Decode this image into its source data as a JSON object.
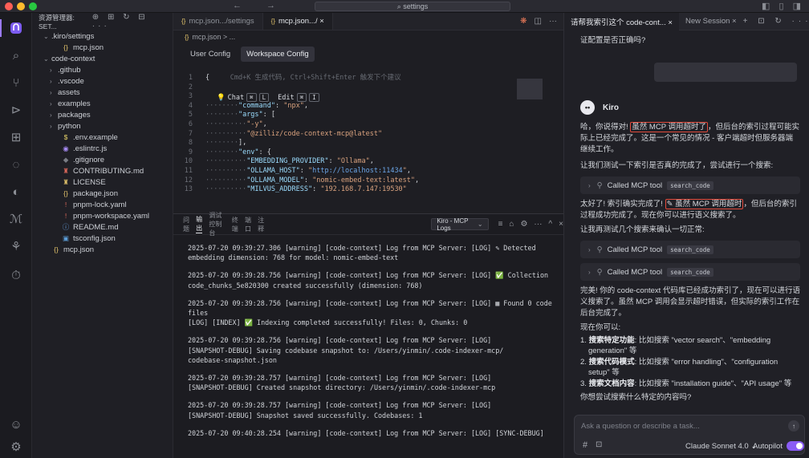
{
  "window": {
    "search_text": "settings",
    "nav_arrows": "← →",
    "window_controls": "◧ ▯ ◨"
  },
  "activity_bar": {
    "items": [
      "kiro-logo",
      "search",
      "source-control",
      "run-debug",
      "extensions",
      "remote",
      "kiro-ghost",
      "kiro-m",
      "mcp"
    ],
    "bottom": [
      "account",
      "settings"
    ]
  },
  "explorer": {
    "header_title": "资源管理器: SET...",
    "header_icons": "⊕ ⊞ ↻ ⊟ ···",
    "rows": [
      {
        "label": ".kiro/settings",
        "indent": 8,
        "arrow": "⌄",
        "icon": "",
        "color": "#cdd0d6"
      },
      {
        "label": "mcp.json",
        "indent": 20,
        "arrow": "",
        "icon": "{}",
        "color": "#e2c36b"
      },
      {
        "label": "code-context",
        "indent": 8,
        "arrow": "⌄",
        "icon": "",
        "color": "#cdd0d6"
      },
      {
        "label": ".github",
        "indent": 16,
        "arrow": "›",
        "icon": "",
        "color": "#cdd0d6"
      },
      {
        "label": ".vscode",
        "indent": 16,
        "arrow": "›",
        "icon": "",
        "color": "#cdd0d6"
      },
      {
        "label": "assets",
        "indent": 16,
        "arrow": "›",
        "icon": "",
        "color": "#cdd0d6"
      },
      {
        "label": "examples",
        "indent": 16,
        "arrow": "›",
        "icon": "",
        "color": "#cdd0d6"
      },
      {
        "label": "packages",
        "indent": 16,
        "arrow": "›",
        "icon": "",
        "color": "#cdd0d6"
      },
      {
        "label": "python",
        "indent": 16,
        "arrow": "›",
        "icon": "",
        "color": "#cdd0d6"
      },
      {
        "label": ".env.example",
        "indent": 20,
        "arrow": "",
        "icon": "$",
        "color": "#e8d36a"
      },
      {
        "label": ".eslintrc.js",
        "indent": 20,
        "arrow": "",
        "icon": "◉",
        "color": "#a88cf6"
      },
      {
        "label": ".gitignore",
        "indent": 20,
        "arrow": "",
        "icon": "◆",
        "color": "#7a7d85"
      },
      {
        "label": "CONTRIBUTING.md",
        "indent": 20,
        "arrow": "",
        "icon": "♜",
        "color": "#e06a5c"
      },
      {
        "label": "LICENSE",
        "indent": 20,
        "arrow": "",
        "icon": "♜",
        "color": "#e2c36b"
      },
      {
        "label": "package.json",
        "indent": 20,
        "arrow": "",
        "icon": "{}",
        "color": "#e2c36b"
      },
      {
        "label": "pnpm-lock.yaml",
        "indent": 20,
        "arrow": "",
        "icon": "!",
        "color": "#e06a5c"
      },
      {
        "label": "pnpm-workspace.yaml",
        "indent": 20,
        "arrow": "",
        "icon": "!",
        "color": "#e06a5c"
      },
      {
        "label": "README.md",
        "indent": 20,
        "arrow": "",
        "icon": "ⓘ",
        "color": "#6ba6e8"
      },
      {
        "label": "tsconfig.json",
        "indent": 20,
        "arrow": "",
        "icon": "▣",
        "color": "#5b9bd5"
      },
      {
        "label": "mcp.json",
        "indent": 8,
        "arrow": "",
        "icon": "{}",
        "color": "#e2c36b"
      }
    ]
  },
  "editor": {
    "tabs": [
      {
        "icon": "{}",
        "label": "mcp.json",
        "detail": " .../settings",
        "active": false
      },
      {
        "icon": "{}",
        "label": "mcp.json",
        "detail": " .../  ×",
        "active": true
      }
    ],
    "tab_actions": [
      "❋",
      "◫",
      "···"
    ],
    "breadcrumb": "mcp.json > ...",
    "config_tabs": [
      {
        "label": "User Config",
        "active": false
      },
      {
        "label": "Workspace Config",
        "active": true
      }
    ],
    "chat_hint": {
      "label": "Chat",
      "k1": "⌘",
      "k2": "L",
      "edit": "Edit",
      "k3": "⌘",
      "k4": "I"
    },
    "code_lines": [
      {
        "n": "1",
        "html": "<span class=\"cl\">{</span>     <span class=\"g\">Cmd+K 生成代码, Ctrl+Shift+Enter 触发下个建议</span>"
      },
      {
        "n": "2",
        "html": ""
      },
      {
        "n": "3",
        "html": ""
      },
      {
        "n": "4",
        "html": "<span class=\"g\">········</span><span class=\"k\">\"command\"</span><span class=\"cl\">: </span><span class=\"s\">\"npx\"</span><span class=\"cl\">,</span>"
      },
      {
        "n": "5",
        "html": "<span class=\"g\">········</span><span class=\"k\">\"args\"</span><span class=\"cl\">: [</span>"
      },
      {
        "n": "6",
        "html": "<span class=\"g\">··········</span><span class=\"s\">\"-y\"</span><span class=\"cl\">,</span>"
      },
      {
        "n": "7",
        "html": "<span class=\"g\">··········</span><span class=\"s\">\"@zilliz/code-context-mcp@latest\"</span>"
      },
      {
        "n": "8",
        "html": "<span class=\"g\">········</span><span class=\"cl\">],</span>"
      },
      {
        "n": "9",
        "html": "<span class=\"g\">········</span><span class=\"k\">\"env\"</span><span class=\"cl\">: {</span>"
      },
      {
        "n": "10",
        "html": "<span class=\"g\">··········</span><span class=\"k\">\"EMBEDDING_PROVIDER\"</span><span class=\"cl\">: </span><span class=\"s\">\"Ollama\"</span><span class=\"cl\">,</span>"
      },
      {
        "n": "11",
        "html": "<span class=\"g\">··········</span><span class=\"k\">\"OLLAMA_HOST\"</span><span class=\"cl\">: </span><span class=\"s\">\"</span><span class=\"h\">http://localhost:11434</span><span class=\"s\">\"</span><span class=\"cl\">,</span>"
      },
      {
        "n": "12",
        "html": "<span class=\"g\">··········</span><span class=\"k\">\"OLLAMA_MODEL\"</span><span class=\"cl\">: </span><span class=\"s\">\"nomic-embed-text:latest\"</span><span class=\"cl\">,</span>"
      },
      {
        "n": "13",
        "html": "<span class=\"g\">··········</span><span class=\"k\">\"MILVUS_ADDRESS\"</span><span class=\"cl\">: </span><span class=\"s\">\"192.168.7.147:19530\"</span>"
      }
    ]
  },
  "panel": {
    "tabs": [
      {
        "label": "问题",
        "active": false
      },
      {
        "label": "输出",
        "active": true
      },
      {
        "label": "调试控制台",
        "active": false
      },
      {
        "label": "终端",
        "active": false
      },
      {
        "label": "端口",
        "active": false
      },
      {
        "label": "注释",
        "active": false
      }
    ],
    "log_source": "Kiro - MCP Logs",
    "icons": [
      "≡",
      "⌂",
      "⚙",
      "···",
      "^",
      "×"
    ],
    "logs": [
      [
        "2025-07-20 09:39:27.306 [warning] [code-context] Log from MCP Server: [LOG] ✎ Detected",
        "embedding dimension: 768 for model: nomic-embed-text"
      ],
      [
        "2025-07-20 09:39:28.756 [warning] [code-context] Log from MCP Server: [LOG] ✅ Collection",
        "code_chunks_5e820300 created successfully (dimension: 768)"
      ],
      [
        "2025-07-20 09:39:28.756 [warning] [code-context] Log from MCP Server: [LOG] ▦ Found 0 code",
        "files",
        "[LOG] [INDEX] ✅ Indexing completed successfully! Files: 0, Chunks: 0"
      ],
      [
        "2025-07-20 09:39:28.756 [warning] [code-context] Log from MCP Server: [LOG]",
        "[SNAPSHOT-DEBUG] Saving codebase snapshot to: /Users/yinmin/.code-indexer-mcp/",
        "codebase-snapshot.json"
      ],
      [
        "2025-07-20 09:39:28.757 [warning] [code-context] Log from MCP Server: [LOG]",
        "[SNAPSHOT-DEBUG] Created snapshot directory: /Users/yinmin/.code-indexer-mcp"
      ],
      [
        "2025-07-20 09:39:28.757 [warning] [code-context] Log from MCP Server: [LOG]",
        "[SNAPSHOT-DEBUG] Snapshot saved successfully. Codebases: 1"
      ],
      [
        "2025-07-20 09:40:28.254 [warning] [code-context] Log from MCP Server: [LOG] [SYNC-DEBUG]"
      ]
    ]
  },
  "chat": {
    "tabs": [
      {
        "label": "请帮我索引这个 code-cont...  ×",
        "active": true
      },
      {
        "label": "New Session  ×",
        "active": false
      }
    ],
    "tab_icons": "+ ⊡ ↻ ···",
    "question_tail": "证配置是否正确吗?",
    "assistant_name": "Kiro",
    "p1_before": "哈，你说得对! ",
    "p1_highlight": "虽然 MCP 调用超时了",
    "p1_after": "，但后台的索引过程可能实际上已经完成了。这是一个常见的情况 - 客户端超时但服务器端继续工作。",
    "p2": "让我们测试一下索引是否真的完成了，尝试进行一个搜索:",
    "tool_label": "Called MCP tool",
    "tool_name": "search_code",
    "p3_before": "太好了! 索引确实完成了! ",
    "p3_highlight": "✎ 虽然 MCP 调用超时",
    "p3_after": "，但后台的索引过程成功完成了。现在你可以进行语义搜索了。",
    "p4": "让我再测试几个搜索来确认一切正常:",
    "p5": "完美! 你的 code-context 代码库已经成功索引了，现在可以进行语义搜索了。虽然 MCP 调用会显示超时错误，但实际的索引工作在后台完成了。",
    "p6": "现在你可以:",
    "steps": [
      {
        "title": "搜索特定功能",
        "text": ": 比如搜索 \"vector search\"、\"embedding generation\" 等"
      },
      {
        "title": "搜索代码模式",
        "text": ": 比如搜索 \"error handling\"、\"configuration setup\" 等"
      },
      {
        "title": "搜索文档内容",
        "text": ": 比如搜索 \"installation guide\"、\"API usage\" 等"
      }
    ],
    "p7": "你想尝试搜索什么特定的内容吗?",
    "input_placeholder": "Ask a question or describe a task...",
    "model": "Claude Sonnet 4.0 ⌄",
    "autopilot": "Autopilot"
  }
}
